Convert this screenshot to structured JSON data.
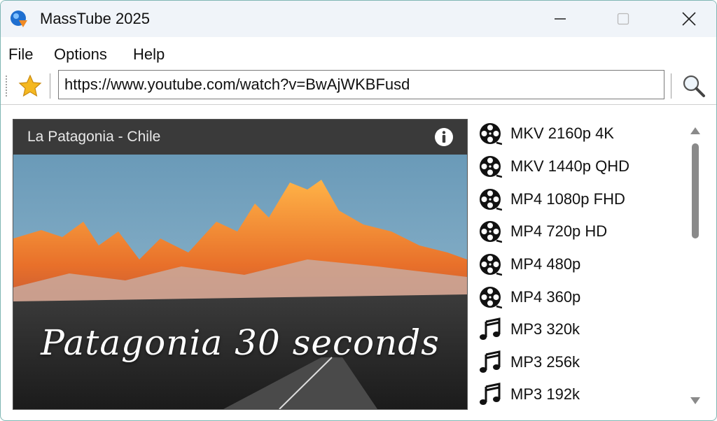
{
  "window": {
    "title": "MassTube 2025"
  },
  "menu": {
    "items": [
      "File",
      "Options",
      "Help"
    ]
  },
  "toolbar": {
    "url": "https://www.youtube.com/watch?v=BwAjWKBFusd"
  },
  "video": {
    "title": "La Patagonia - Chile",
    "thumbnail_caption": "Patagonia 30 seconds"
  },
  "formats": [
    {
      "label": "MKV 2160p 4K",
      "icon": "film-reel-icon"
    },
    {
      "label": "MKV 1440p QHD",
      "icon": "film-reel-icon"
    },
    {
      "label": "MP4 1080p FHD",
      "icon": "film-reel-icon"
    },
    {
      "label": "MP4 720p HD",
      "icon": "film-reel-icon"
    },
    {
      "label": "MP4 480p",
      "icon": "film-reel-icon"
    },
    {
      "label": "MP4 360p",
      "icon": "film-reel-icon"
    },
    {
      "label": "MP3 320k",
      "icon": "music-note-icon"
    },
    {
      "label": "MP3 256k",
      "icon": "music-note-icon"
    },
    {
      "label": "MP3 192k",
      "icon": "music-note-icon"
    }
  ],
  "colors": {
    "star": "#f5b820",
    "app_icon_blue": "#1f6fd0",
    "app_icon_orange": "#f08a24"
  }
}
